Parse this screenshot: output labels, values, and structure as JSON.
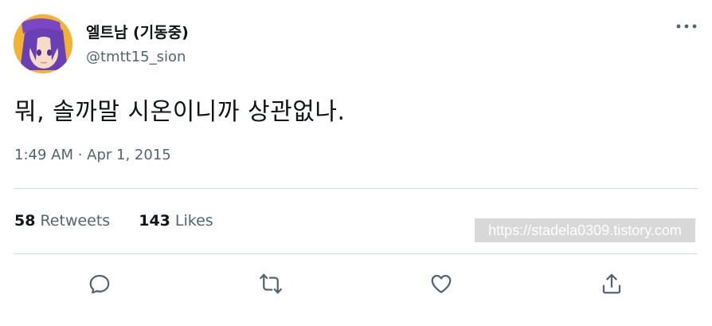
{
  "author": {
    "display_name": "엘트남 (기동중)",
    "handle": "@tmtt15_sion",
    "avatar_icon": "anime-character-avatar"
  },
  "tweet": {
    "text": "뭐, 솔까말 시온이니까 상관없나.",
    "timestamp": "1:49 AM · Apr 1, 2015"
  },
  "stats": {
    "retweets_count": "58",
    "retweets_label": "Retweets",
    "likes_count": "143",
    "likes_label": "Likes"
  },
  "watermark": {
    "text": "https://stadela0309.tistory.com"
  },
  "actions": {
    "reply_icon": "reply-icon",
    "retweet_icon": "retweet-icon",
    "like_icon": "heart-icon",
    "share_icon": "share-icon"
  },
  "colors": {
    "primary_text": "#0f1419",
    "secondary_text": "#536471",
    "divider": "#cfd9de",
    "avatar_bg": "#f2b233"
  }
}
